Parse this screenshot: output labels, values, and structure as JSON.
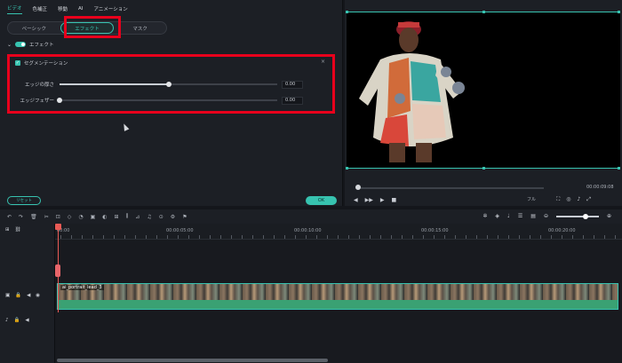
{
  "panel": {
    "top_tabs": [
      "ビデオ",
      "色補正",
      "移動",
      "AI",
      "アニメーション"
    ],
    "segment_tabs": [
      "ベーシック",
      "エフェクト",
      "マスク"
    ],
    "effect_section_label": "エフェクト",
    "segmentation": {
      "title": "セグメンテーション",
      "sliders": [
        {
          "label": "エッジの厚さ",
          "value_text": "0.00",
          "level": 0.5
        },
        {
          "label": "エッジフェザー",
          "value_text": "0.00",
          "level": 0.0
        }
      ]
    },
    "reset_label": "リセット",
    "ok_label": "OK"
  },
  "preview": {
    "timecode": "00:00:09:08",
    "quality": "フル",
    "scrub_level": 0.0
  },
  "timeline": {
    "ruler_labels": [
      "00:00",
      "00:00:05:00",
      "00:00:10:00",
      "00:00:15:00",
      "00:00:20:00"
    ],
    "clip_label": "ai_portrait_lead_3"
  },
  "colors": {
    "accent": "#37c3b0",
    "highlight": "#e8001c",
    "playhead": "#e85a55"
  },
  "icons": [
    "chevron-down-icon",
    "checkbox-icon",
    "close-icon",
    "play-icon",
    "stop-icon",
    "step-back-icon",
    "step-forward-icon",
    "undo-icon",
    "redo-icon",
    "delete-icon",
    "cut-icon",
    "snapshot-icon",
    "volume-icon",
    "zoom-out-icon",
    "zoom-in-icon",
    "lock-icon",
    "eye-icon"
  ]
}
